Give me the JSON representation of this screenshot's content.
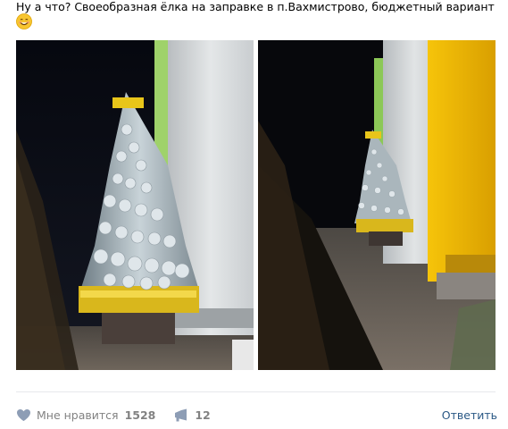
{
  "post": {
    "text": "Ну а что? Своеобразная ёлка на заправке в п.Вахмистрово, бюджетный вариант",
    "emoji": "smiling-face-icon"
  },
  "photos": [
    {
      "name": "christmas-tree-photo-closeup"
    },
    {
      "name": "christmas-tree-photo-wide"
    }
  ],
  "actions": {
    "like_label": "Мне нравится",
    "like_count": "1528",
    "share_count": "12",
    "reply_label": "Ответить"
  },
  "colors": {
    "link": "#2a5885",
    "muted": "#828282",
    "divider": "#e7e8ec",
    "gas_station_yellow": "#f2b705",
    "tinsel_gold": "#e8c51a"
  }
}
